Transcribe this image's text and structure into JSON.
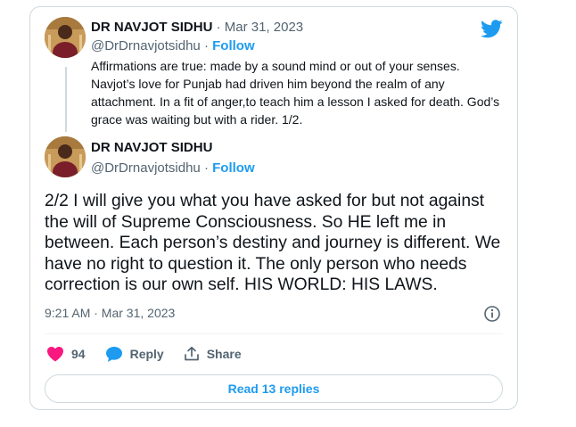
{
  "quoted_tweet": {
    "author_name": "DR NAVJOT SIDHU",
    "separator": "·",
    "date": "Mar 31, 2023",
    "handle": "@DrDrnavjotsidhu",
    "follow_label": "Follow",
    "text": "Affirmations are true: made by a sound mind or out of your senses. Navjot’s love for Punjab had driven him beyond the realm of any attachment. In a fit of anger,to teach him a lesson I asked for death. God’s grace was waiting but with a rider. 1/2."
  },
  "main_tweet": {
    "author_name": "DR NAVJOT SIDHU",
    "handle": "@DrDrnavjotsidhu",
    "separator": "·",
    "follow_label": "Follow",
    "text": "2/2 I will give you what you have asked for but not against the will of Supreme Consciousness. So HE left me in between. Each person’s destiny and journey is different. We have no right to question it. The only person who needs correction is our own self. HIS WORLD: HIS LAWS.",
    "timestamp": "9:21 AM · Mar 31, 2023"
  },
  "actions": {
    "likes": "94",
    "reply_label": "Reply",
    "share_label": "Share"
  },
  "read_replies_label": "Read 13 replies",
  "icons": {
    "brand": "twitter-bird-icon",
    "info": "info-icon",
    "like": "heart-icon",
    "reply": "reply-bubble-icon",
    "share": "share-icon"
  },
  "colors": {
    "twitter_blue": "#1d9bf0",
    "like_pink": "#f91880",
    "muted": "#536471",
    "border": "#cfd9de"
  }
}
